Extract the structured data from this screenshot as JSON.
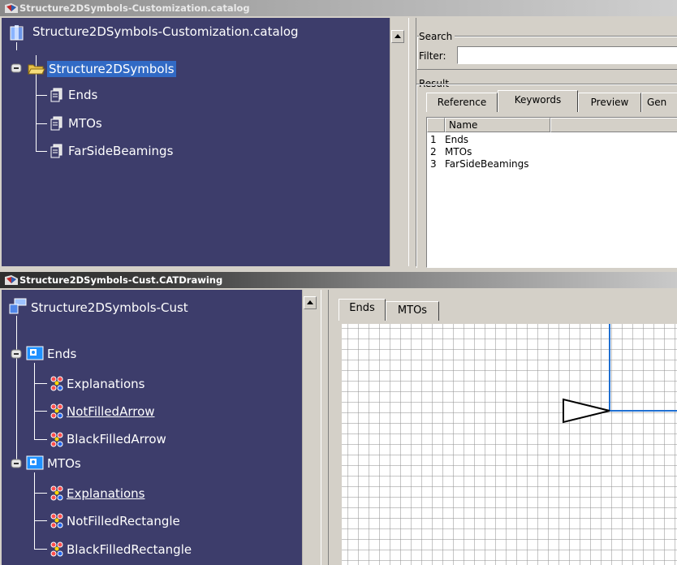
{
  "top_window": {
    "title": "Structure2DSymbols-Customization.catalog",
    "tree": {
      "root": "Structure2DSymbols-Customization.catalog",
      "folder": "Structure2DSymbols",
      "items": [
        "Ends",
        "MTOs",
        "FarSideBeamings"
      ]
    },
    "search": {
      "group_label": "Search",
      "filter_label": "Filter:",
      "filter_value": "",
      "result_label": "Result",
      "tabs": [
        "Reference",
        "Keywords",
        "Preview",
        "Gen"
      ],
      "active_tab": "Keywords",
      "column_header": "Name",
      "rows": [
        {
          "num": "1",
          "name": "Ends"
        },
        {
          "num": "2",
          "name": "MTOs"
        },
        {
          "num": "3",
          "name": "FarSideBeamings"
        }
      ]
    }
  },
  "bottom_window": {
    "title": "Structure2DSymbols-Cust.CATDrawing",
    "tree": {
      "root": "Structure2DSymbols-Cust",
      "groups": [
        {
          "name": "Ends",
          "children": [
            "Explanations",
            "NotFilledArrow",
            "BlackFilledArrow"
          ]
        },
        {
          "name": "MTOs",
          "children": [
            "Explanations",
            "NotFilledRectangle",
            "BlackFilledRectangle"
          ]
        }
      ]
    },
    "sheet_tabs": [
      "Ends",
      "MTOs"
    ],
    "active_sheet": "Ends"
  },
  "colors": {
    "tree_background": "#3d3d6b",
    "selection": "#316ac5",
    "drawing_line": "#1f6fd1"
  }
}
